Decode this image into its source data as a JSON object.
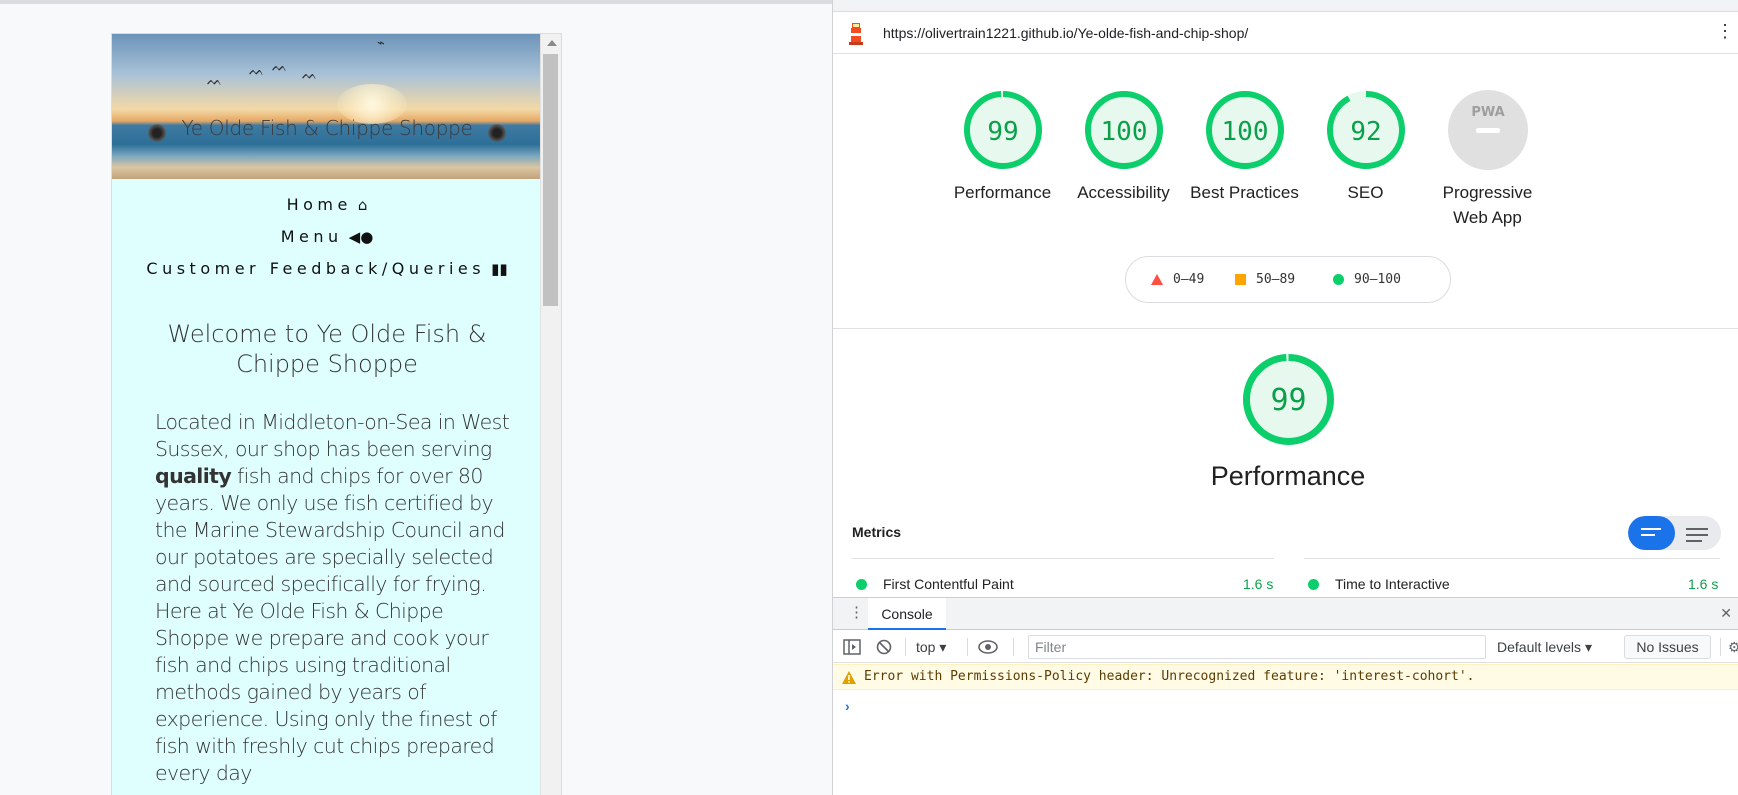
{
  "device": {
    "hero_title": "Ye Olde Fish & Chippe Shoppe",
    "nav": [
      {
        "label": "Home",
        "icon": "home-icon"
      },
      {
        "label": "Menu",
        "icon": "fish-icon"
      },
      {
        "label": "Customer Feedback/Queries",
        "icon": "book-icon"
      }
    ],
    "welcome": "Welcome to Ye Olde Fish & Chippe Shoppe",
    "intro_before_bold": "Located in Middleton-on-Sea in West Sussex, our shop has been serving ",
    "intro_bold": "quality",
    "intro_after_bold": " fish and chips for over 80 years. We only use fish certified by the Marine Stewardship Council and our potatoes are specially selected and sourced specifically for frying. Here at Ye Olde Fish & Chippe Shoppe we prepare and cook your fish and chips using traditional methods gained by years of experience. Using only the finest of fish with freshly cut chips prepared every day"
  },
  "devtools": {
    "url": "https://olivertrain1221.github.io/Ye-olde-fish-and-chip-shop/",
    "gauges": [
      {
        "score": "99",
        "label": "Performance",
        "fraction": 0.99,
        "color": "#0cce6b"
      },
      {
        "score": "100",
        "label": "Accessibility",
        "fraction": 1.0,
        "color": "#0cce6b"
      },
      {
        "score": "100",
        "label": "Best Practices",
        "fraction": 1.0,
        "color": "#0cce6b"
      },
      {
        "score": "92",
        "label": "SEO",
        "fraction": 0.92,
        "color": "#0cce6b"
      },
      {
        "score": "",
        "label": "Progressive Web App",
        "badge": "PWA",
        "fraction": 0,
        "color": "#9e9e9e"
      }
    ],
    "legend": [
      {
        "range": "0–49",
        "shape": "triangle",
        "color": "#ff4e42"
      },
      {
        "range": "50–89",
        "shape": "square",
        "color": "#ffa400"
      },
      {
        "range": "90–100",
        "shape": "circle",
        "color": "#0cce6b"
      }
    ],
    "performance": {
      "score": "99",
      "title": "Performance",
      "fraction": 0.99
    },
    "metrics_title": "Metrics",
    "metrics": [
      {
        "label": "First Contentful Paint",
        "value": "1.6 s"
      },
      {
        "label": "Time to Interactive",
        "value": "1.6 s"
      }
    ],
    "console": {
      "tab_label": "Console",
      "context": "top",
      "filter_placeholder": "Filter",
      "levels": "Default levels",
      "issues": "No Issues",
      "warning": "Error with Permissions-Policy header: Unrecognized feature: 'interest-cohort'."
    }
  }
}
